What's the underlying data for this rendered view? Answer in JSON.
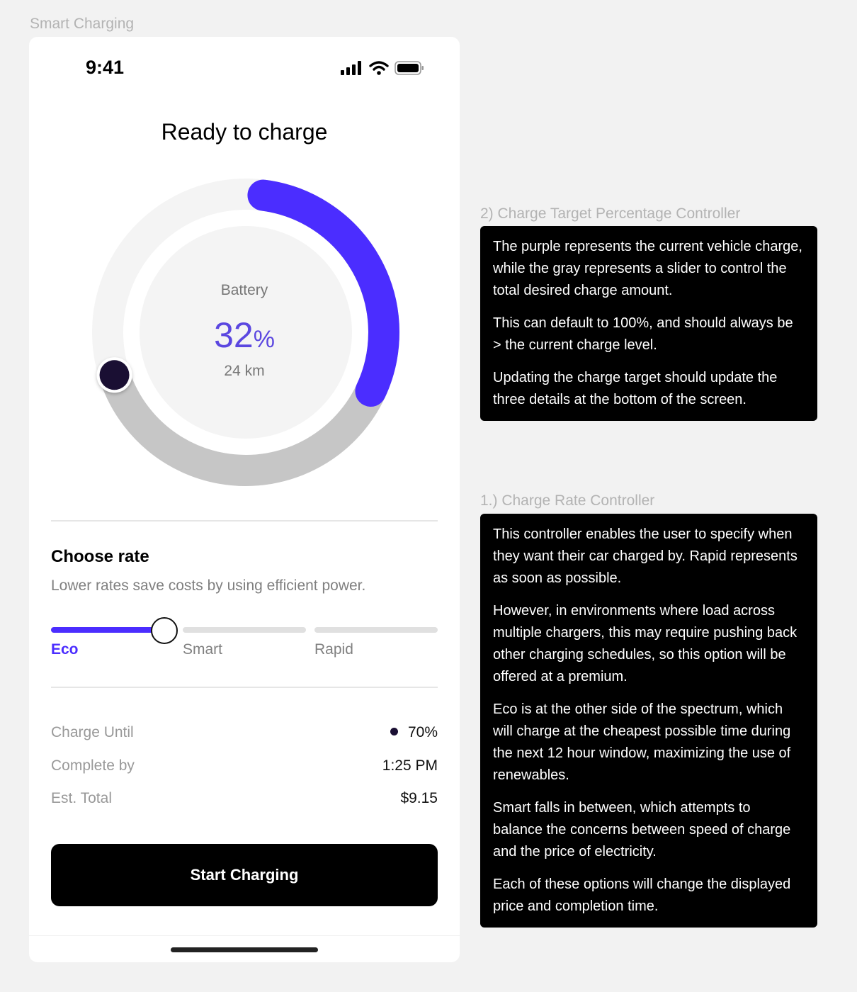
{
  "frame_label": "Smart Charging",
  "status_bar": {
    "time": "9:41",
    "icons": [
      "signal-icon",
      "wifi-icon",
      "battery-icon"
    ]
  },
  "screen": {
    "title": "Ready to charge",
    "battery": {
      "label": "Battery",
      "percent": "32",
      "percent_unit": "%",
      "range": "24 km",
      "current_charge_fraction": 0.32,
      "target_fraction": 0.7
    },
    "rate": {
      "title": "Choose rate",
      "subtitle": "Lower rates save costs by using efficient power.",
      "options": [
        "Eco",
        "Smart",
        "Rapid"
      ],
      "selected": "Eco"
    },
    "details": [
      {
        "key": "Charge Until",
        "value": "70%"
      },
      {
        "key": "Complete by",
        "value": "1:25 PM"
      },
      {
        "key": "Est. Total",
        "value": "$9.15"
      }
    ],
    "cta": "Start Charging"
  },
  "notes": [
    {
      "heading": "2) Charge Target Percentage Controller",
      "paragraphs": [
        "The purple represents the current vehicle charge, while the gray represents a slider to control the total desired charge amount.",
        "This can default to 100%, and should always be > the current charge level.",
        "Updating the charge target should update the three details at the bottom of the screen."
      ]
    },
    {
      "heading": "1.) Charge Rate Controller",
      "paragraphs": [
        "This controller enables the user to specify when they want their car charged by. Rapid represents as soon as possible.",
        "However, in environments where load across multiple chargers, this may require pushing back other charging schedules, so this option will be offered at a premium.",
        "Eco is at the other side of the spectrum, which will charge at the cheapest possible time during the next 12 hour window, maximizing the use of renewables.",
        "Smart falls in between, which attempts to balance the concerns between speed of charge and the price of electricity.",
        "Each of these options will change the displayed price and completion time."
      ]
    }
  ],
  "colors": {
    "accent": "#4b2dff",
    "accent_text": "#5b47e0",
    "target_gray": "#c6c6c6",
    "track_light": "#f4f4f4",
    "knob_dark": "#1a0f33",
    "cta_bg": "#000000",
    "note_bg": "#000000"
  }
}
